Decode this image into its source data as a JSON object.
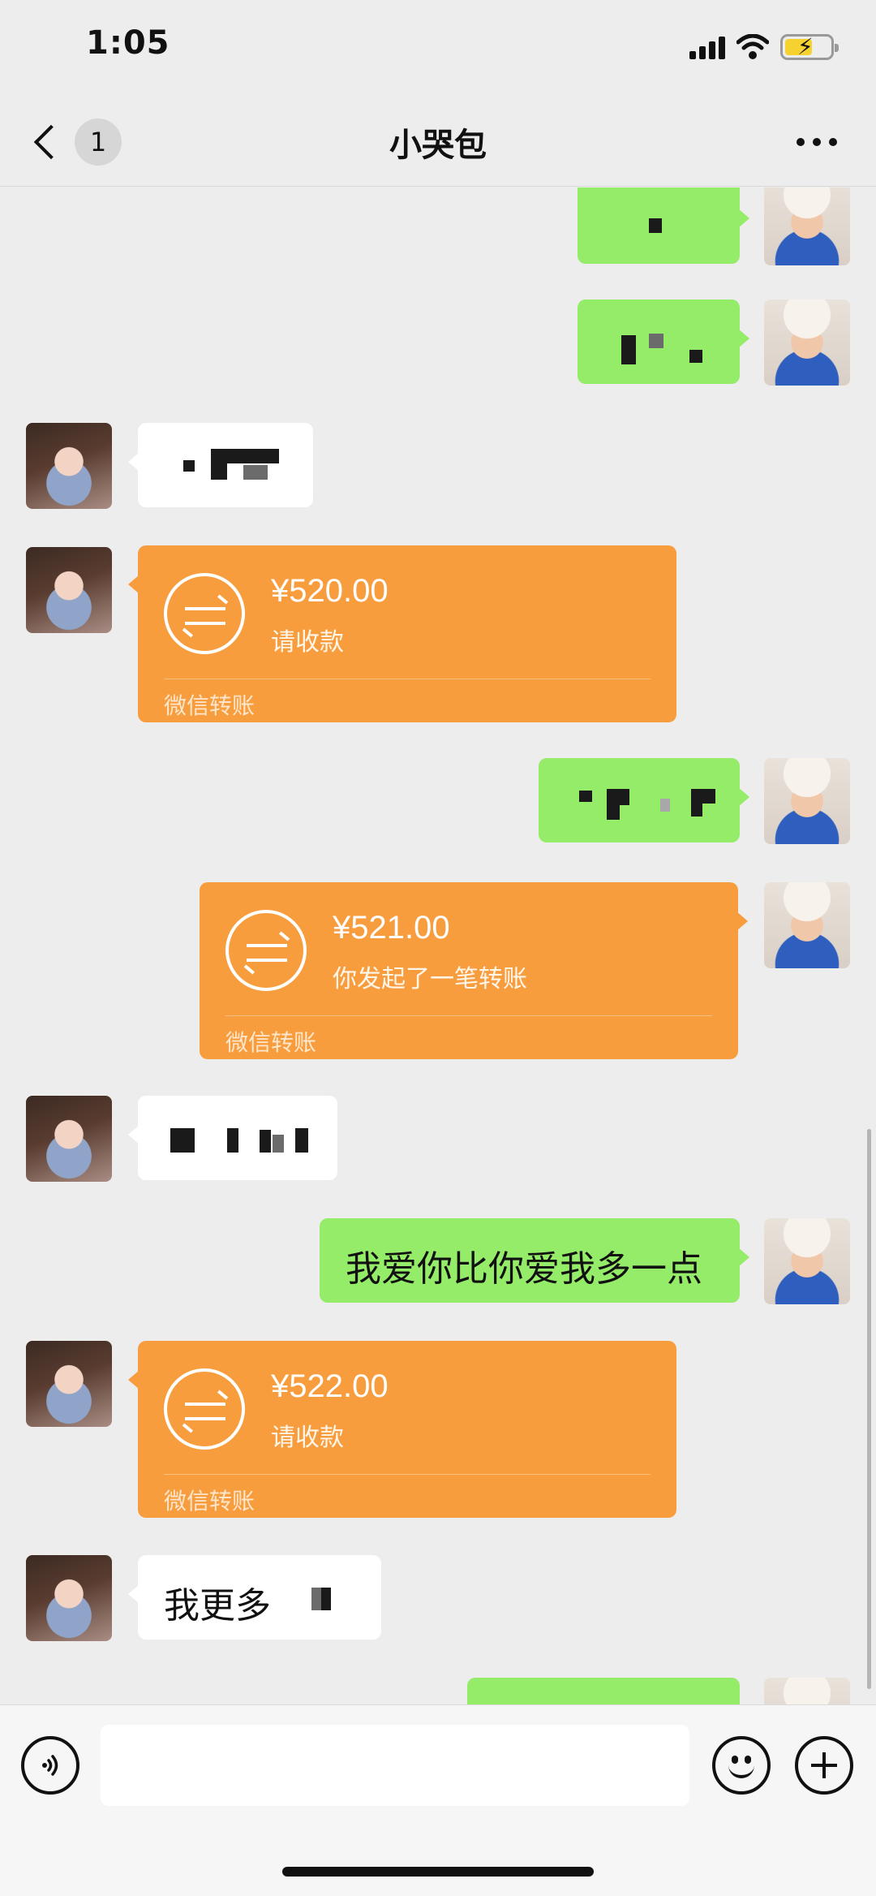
{
  "status_bar": {
    "time": "1:05"
  },
  "header": {
    "back_badge": "1",
    "title": "小哭包",
    "more_icon": "more-dots-icon"
  },
  "messages": [
    {
      "sender": "me",
      "type": "text",
      "text": ""
    },
    {
      "sender": "me",
      "type": "text",
      "text": ""
    },
    {
      "sender": "them",
      "type": "text",
      "text": ""
    },
    {
      "sender": "them",
      "type": "transfer",
      "amount": "¥520.00",
      "note": "请收款",
      "footer": "微信转账"
    },
    {
      "sender": "me",
      "type": "text",
      "text": ""
    },
    {
      "sender": "me",
      "type": "transfer",
      "amount": "¥521.00",
      "note": "你发起了一笔转账",
      "footer": "微信转账"
    },
    {
      "sender": "them",
      "type": "text",
      "text": ""
    },
    {
      "sender": "me",
      "type": "text",
      "text": "我爱你比你爱我多一点"
    },
    {
      "sender": "them",
      "type": "transfer",
      "amount": "¥522.00",
      "note": "请收款",
      "footer": "微信转账"
    },
    {
      "sender": "them",
      "type": "text",
      "text": "我更多"
    },
    {
      "sender": "me",
      "type": "text",
      "text": ""
    }
  ],
  "input_bar": {
    "voice_icon": "voice-icon",
    "input_value": "",
    "emoji_icon": "emoji-icon",
    "plus_icon": "plus-icon"
  },
  "colors": {
    "background": "#ededed",
    "my_bubble": "#95ec69",
    "their_bubble": "#ffffff",
    "transfer_card": "#f89d3e"
  }
}
